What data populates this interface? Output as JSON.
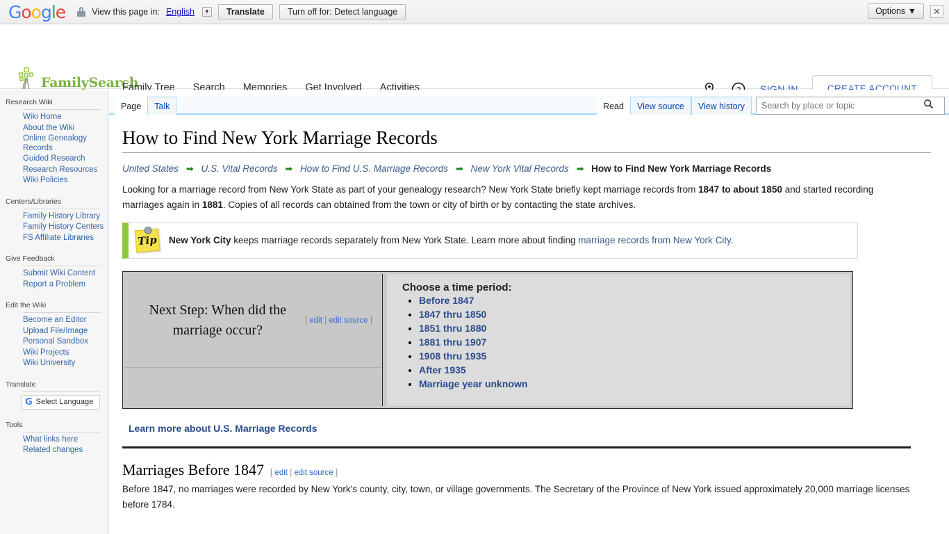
{
  "translate_bar": {
    "logo": "Google",
    "lock_icon": "lock-icon",
    "view_label": "View this page in:",
    "language": "English",
    "translate_button": "Translate",
    "turnoff_button": "Turn off for: Detect language",
    "options_button": "Options ▼",
    "close_icon": "✕"
  },
  "site_header": {
    "brand": "FamilySearch",
    "nav": [
      {
        "label": "Family Tree"
      },
      {
        "label": "Search"
      },
      {
        "label": "Memories"
      },
      {
        "label": "Get Involved"
      },
      {
        "label": "Activities"
      }
    ],
    "location_icon": "map-pin-icon",
    "help_icon": "help-circle-icon",
    "sign_in": "SIGN IN",
    "create_account": "CREATE ACCOUNT"
  },
  "sidebar": {
    "sections": [
      {
        "title": "Research Wiki",
        "items": [
          "Wiki Home",
          "About the Wiki",
          "Online Genealogy Records",
          "Guided Research",
          "Research Resources",
          "Wiki Policies"
        ]
      },
      {
        "title": "Centers/Libraries",
        "items": [
          "Family History Library",
          "Family History Centers",
          "FS Affiliate Libraries"
        ]
      },
      {
        "title": "Give Feedback",
        "items": [
          "Submit Wiki Content",
          "Report a Problem"
        ]
      },
      {
        "title": "Edit the Wiki",
        "items": [
          "Become an Editor",
          "Upload File/Image",
          "Personal Sandbox",
          "Wiki Projects",
          "Wiki University"
        ]
      },
      {
        "title": "Translate",
        "items": []
      },
      {
        "title": "Tools",
        "items": [
          "What links here",
          "Related changes"
        ]
      }
    ],
    "select_language": "Select Language"
  },
  "tabs": {
    "left": [
      {
        "label": "Page",
        "selected": true
      },
      {
        "label": "Talk",
        "selected": false
      }
    ],
    "right": [
      {
        "label": "Read",
        "selected": true
      },
      {
        "label": "View source",
        "selected": false
      },
      {
        "label": "View history",
        "selected": false
      }
    ]
  },
  "search": {
    "placeholder": "Search by place or topic",
    "value": "",
    "icon": "search-icon"
  },
  "page": {
    "title": "How to Find New York Marriage Records",
    "breadcrumb": {
      "items": [
        "United States",
        "U.S. Vital Records",
        "How to Find U.S. Marriage Records",
        "New York Vital Records"
      ],
      "current": "How to Find New York Marriage Records",
      "separator": "➡"
    },
    "intro": {
      "part1": "Looking for a marriage record from New York State as part of your genealogy research? New York State briefly kept marriage records from ",
      "bold1": "1847 to about 1850",
      "part2": " and started recording marriages again in ",
      "bold2": "1881",
      "part3": ". Copies of all records can obtained from the town or city of birth or by contacting the state archives."
    },
    "tip": {
      "icon_label": "Tip",
      "bold": "New York City",
      "text": " keeps marriage records separately from New York State. Learn more about finding ",
      "link": "marriage records from New York City",
      "tail": "."
    },
    "timeperiod": {
      "next_step": "Next Step: When did the marriage occur?",
      "edit_open": "[",
      "edit": "edit",
      "edit_pipe": "|",
      "edit_source": "edit source",
      "edit_close": "]",
      "heading": "Choose a time period:",
      "options": [
        "Before 1847",
        "1847 thru 1850",
        "1851 thru 1880",
        "1881 thru 1907",
        "1908 thru 1935",
        "After 1935",
        "Marriage year unknown"
      ]
    },
    "learn_more": "Learn more about U.S. Marriage Records",
    "section": {
      "title": "Marriages Before 1847",
      "edit_open": "[",
      "edit": "edit",
      "edit_pipe": "|",
      "edit_source": "edit source",
      "edit_close": "]",
      "body": "Before 1847, no marriages were recorded by New York's county, city, town, or village governments. The Secretary of the Province of New York issued approximately 20,000 marriage licenses before 1784."
    }
  },
  "colors": {
    "brand_green": "#7cb342",
    "link_blue": "#2a4b8d",
    "tab_blue": "#a7d7f9",
    "tip_green": "#8cc63e"
  }
}
